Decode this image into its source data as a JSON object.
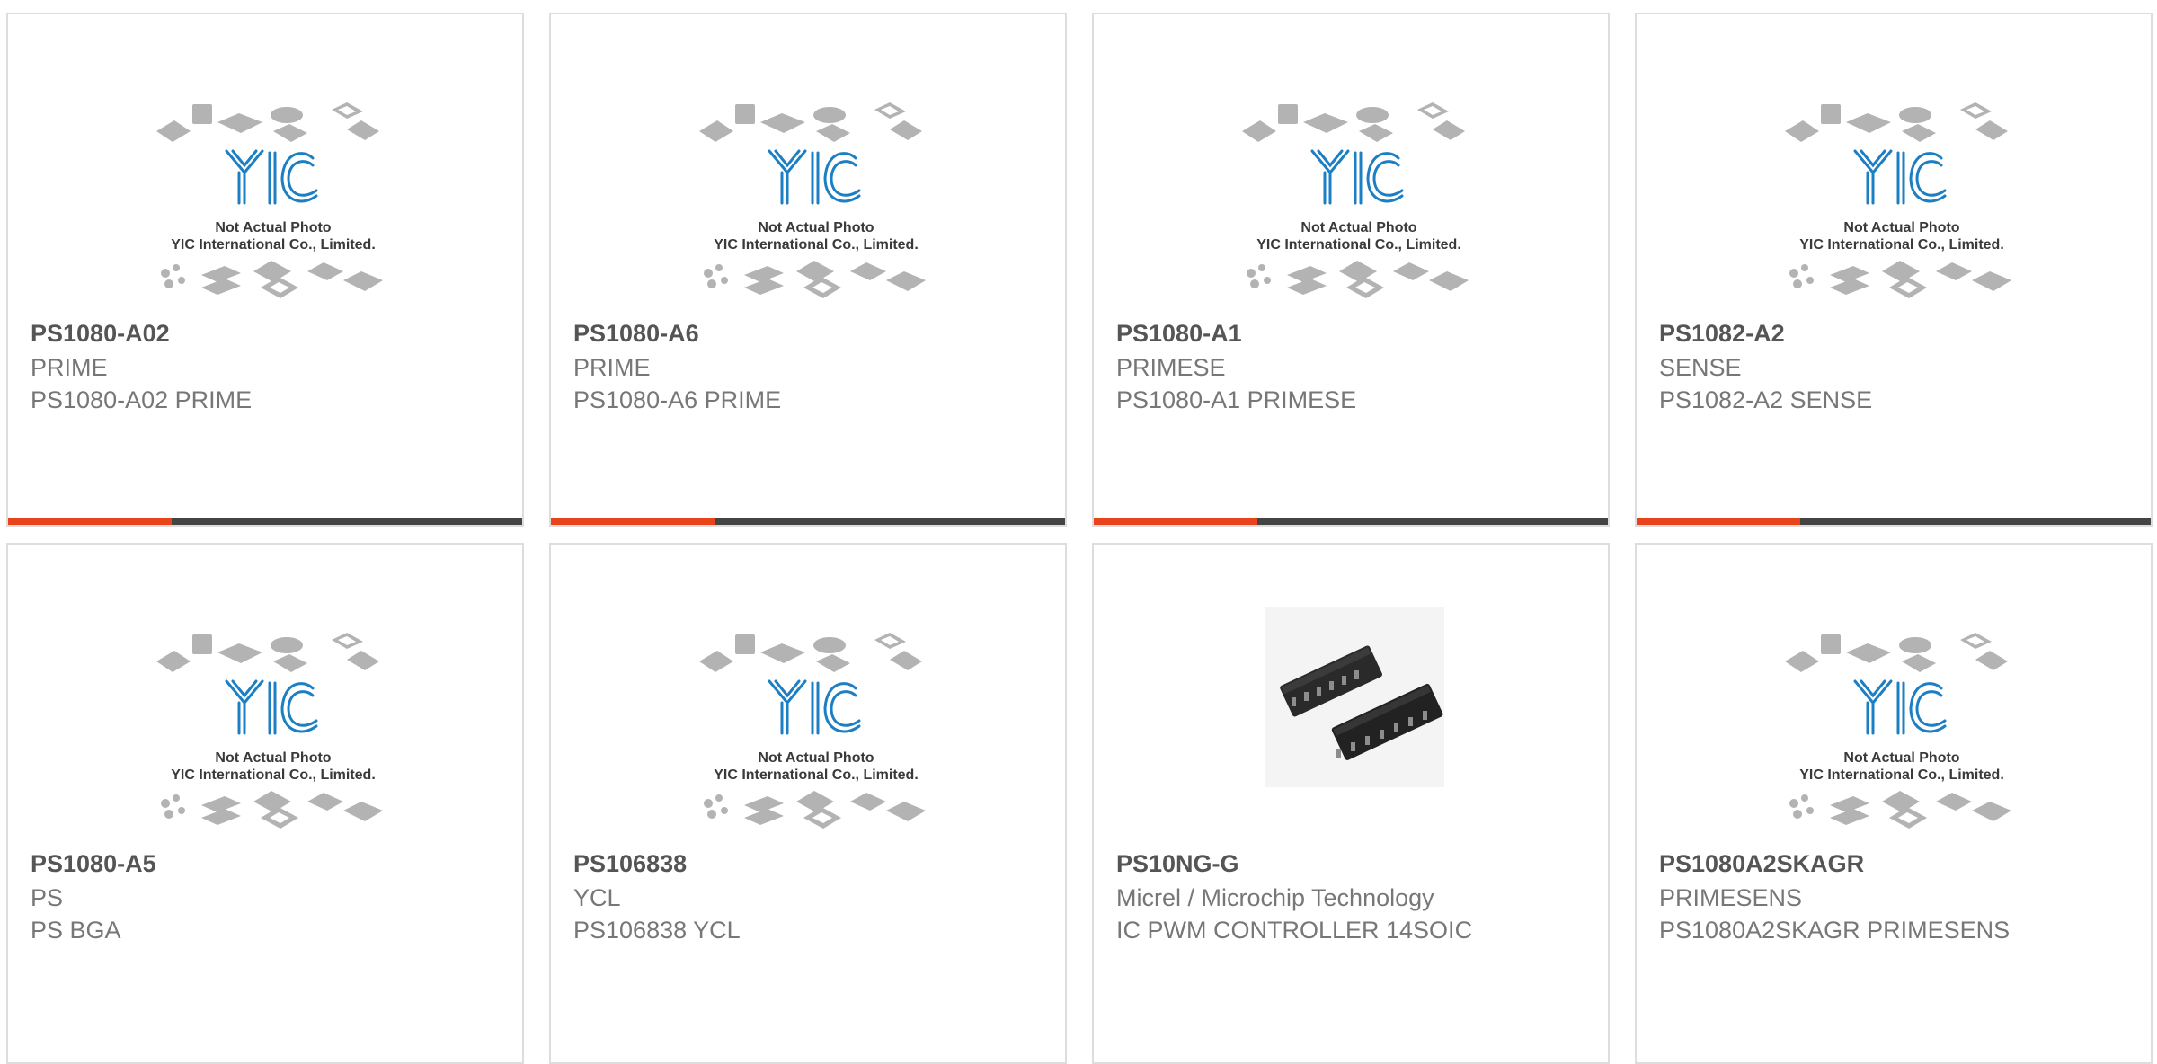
{
  "colors": {
    "accent": "#e8431b",
    "bar": "#444444",
    "logo_blue": "#1c7fc4",
    "text_bold": "#555555",
    "text": "#777777"
  },
  "placeholder": {
    "line1": "Not Actual Photo",
    "line2": "YIC International Co., Limited.",
    "logo_text": "YIC"
  },
  "products": [
    {
      "part": "PS1080-A02",
      "manufacturer": "PRIME",
      "description": "PS1080-A02 PRIME",
      "image": "placeholder"
    },
    {
      "part": "PS1080-A6",
      "manufacturer": "PRIME",
      "description": "PS1080-A6 PRIME",
      "image": "placeholder"
    },
    {
      "part": "PS1080-A1",
      "manufacturer": "PRIMESE",
      "description": "PS1080-A1 PRIMESE",
      "image": "placeholder"
    },
    {
      "part": "PS1082-A2",
      "manufacturer": "SENSE",
      "description": "PS1082-A2 SENSE",
      "image": "placeholder"
    },
    {
      "part": "PS1080-A5",
      "manufacturer": "PS",
      "description": "PS BGA",
      "image": "placeholder"
    },
    {
      "part": "PS106838",
      "manufacturer": "YCL",
      "description": "PS106838 YCL",
      "image": "placeholder"
    },
    {
      "part": "PS10NG-G",
      "manufacturer": "Micrel / Microchip Technology",
      "description": "IC PWM CONTROLLER 14SOIC",
      "image": "soic-chip-photo"
    },
    {
      "part": "PS1080A2SKAGR",
      "manufacturer": "PRIMESENS",
      "description": "PS1080A2SKAGR PRIMESENS",
      "image": "placeholder"
    }
  ]
}
